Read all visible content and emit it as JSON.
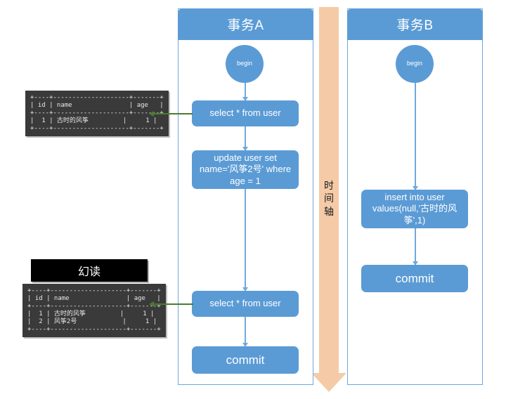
{
  "diagram": {
    "title": "幻读 (Phantom Read) transaction timeline",
    "colors": {
      "node_blue": "#5B9BD5",
      "lane_border": "#6FA8DC",
      "timeline_peach": "#F5CBA7",
      "read_arrow_green": "#4A7C2F",
      "terminal_bg": "#3A3A3A",
      "label_bg": "#000000"
    }
  },
  "timeline": {
    "label_chars": [
      "时",
      "间",
      "轴"
    ],
    "label": "时间轴",
    "direction": "down"
  },
  "lanes": [
    {
      "id": "transaction-a",
      "header": "事务A",
      "steps": [
        {
          "id": "begin",
          "shape": "circle",
          "label": "begin"
        },
        {
          "id": "select-1",
          "shape": "rounded-rect",
          "label": "select * from user"
        },
        {
          "id": "update",
          "shape": "rounded-rect",
          "label": "update user set name='风筝2号' where age = 1"
        },
        {
          "id": "select-2",
          "shape": "rounded-rect",
          "label": "select * from user"
        },
        {
          "id": "commit",
          "shape": "rounded-rect",
          "label": "commit"
        }
      ]
    },
    {
      "id": "transaction-b",
      "header": "事务B",
      "steps": [
        {
          "id": "begin",
          "shape": "circle",
          "label": "begin"
        },
        {
          "id": "insert",
          "shape": "rounded-rect",
          "label": "insert into user values(null,'古时的风筝',1)"
        },
        {
          "id": "commit",
          "shape": "rounded-rect",
          "label": "commit"
        }
      ]
    }
  ],
  "results": [
    {
      "id": "result-first-select",
      "header_label": null,
      "text": "+----+--------------------+-------+\n| id | name               | age   |\n+----+--------------------+-------+\n|  1 | 古时的风筝         |     1 |\n+----+--------------------+-------+",
      "columns": [
        "id",
        "name",
        "age"
      ],
      "rows": [
        [
          "1",
          "古时的风筝",
          "1"
        ]
      ]
    },
    {
      "id": "result-second-select",
      "header_label": "幻读",
      "text": "+----+--------------------+-------+\n| id | name               | age   |\n+----+--------------------+-------+\n|  1 | 古时的风筝         |     1 |\n|  2 | 风筝2号            |     1 |\n+----+--------------------+-------+",
      "columns": [
        "id",
        "name",
        "age"
      ],
      "rows": [
        [
          "1",
          "古时的风筝",
          "1"
        ],
        [
          "2",
          "风筝2号",
          "1"
        ]
      ]
    }
  ]
}
